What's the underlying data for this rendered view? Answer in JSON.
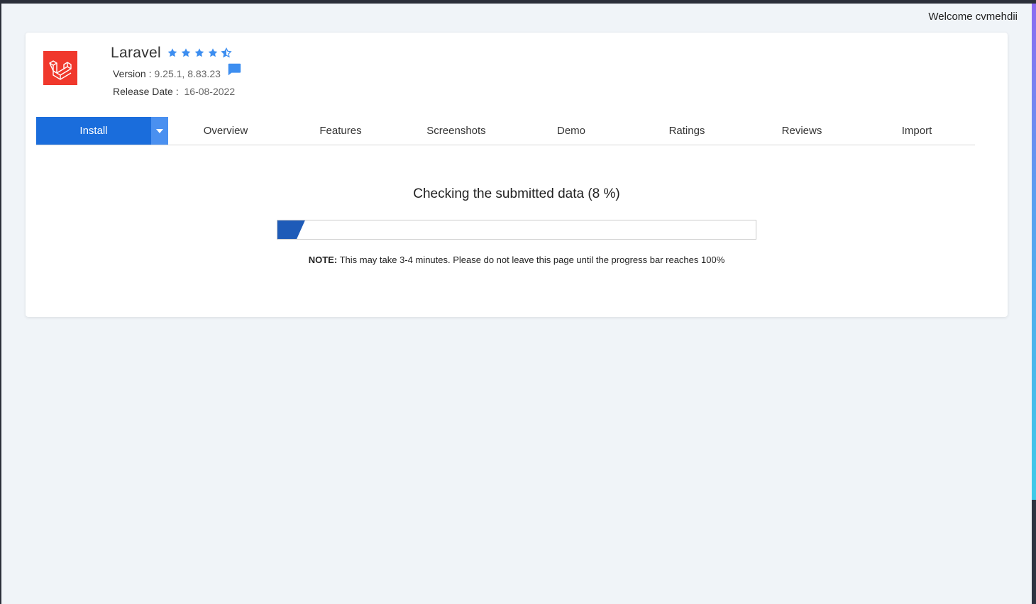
{
  "header": {
    "welcome_text": "Welcome cvmehdii"
  },
  "app": {
    "name": "Laravel",
    "rating": 4.5,
    "rating_max": 5,
    "version_label": "Version :",
    "version_value": "9.25.1, 8.83.23",
    "release_label": "Release Date :",
    "release_value": "16-08-2022",
    "logo_color": "#f0382c"
  },
  "tabs": {
    "install_label": "Install",
    "items": [
      {
        "label": "Overview"
      },
      {
        "label": "Features"
      },
      {
        "label": "Screenshots"
      },
      {
        "label": "Demo"
      },
      {
        "label": "Ratings"
      },
      {
        "label": "Reviews"
      },
      {
        "label": "Import"
      }
    ]
  },
  "progress": {
    "title": "Checking the submitted data (8 %)",
    "percent": 8,
    "note_label": "NOTE:",
    "note_text": "This may take 3-4 minutes. Please do not leave this page until the progress bar reaches 100%"
  },
  "colors": {
    "primary": "#1a6ddc",
    "primary_light": "#4a90f0",
    "progress_fill": "#1e5bb8",
    "star": "#3d8ef0"
  }
}
